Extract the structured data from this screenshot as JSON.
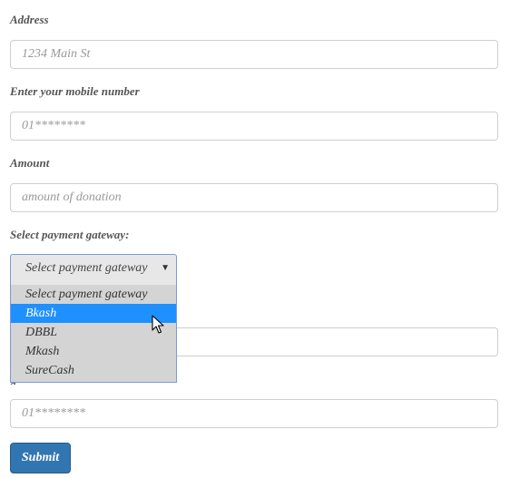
{
  "form": {
    "address": {
      "label": "Address",
      "placeholder": "1234 Main St"
    },
    "mobile": {
      "label": "Enter your mobile number",
      "placeholder": "01********"
    },
    "amount": {
      "label": "Amount",
      "placeholder": "amount of donation"
    },
    "gateway": {
      "label": "Select payment gateway:",
      "selected": "Select payment gateway",
      "options": [
        {
          "label": "Select payment gateway"
        },
        {
          "label": "Bkash",
          "highlighted": true
        },
        {
          "label": "DBBL"
        },
        {
          "label": "Mkash"
        },
        {
          "label": "SureCash"
        }
      ]
    },
    "transaction_field": {
      "placeholder": ""
    },
    "second_mobile": {
      "placeholder": "01********"
    },
    "submit_label": "Submit"
  },
  "colors": {
    "highlight": "#1e90ff",
    "submit_bg": "#3276b1",
    "dropdown_bg": "#d4d4d4",
    "focus_border": "#7a9bd8"
  }
}
